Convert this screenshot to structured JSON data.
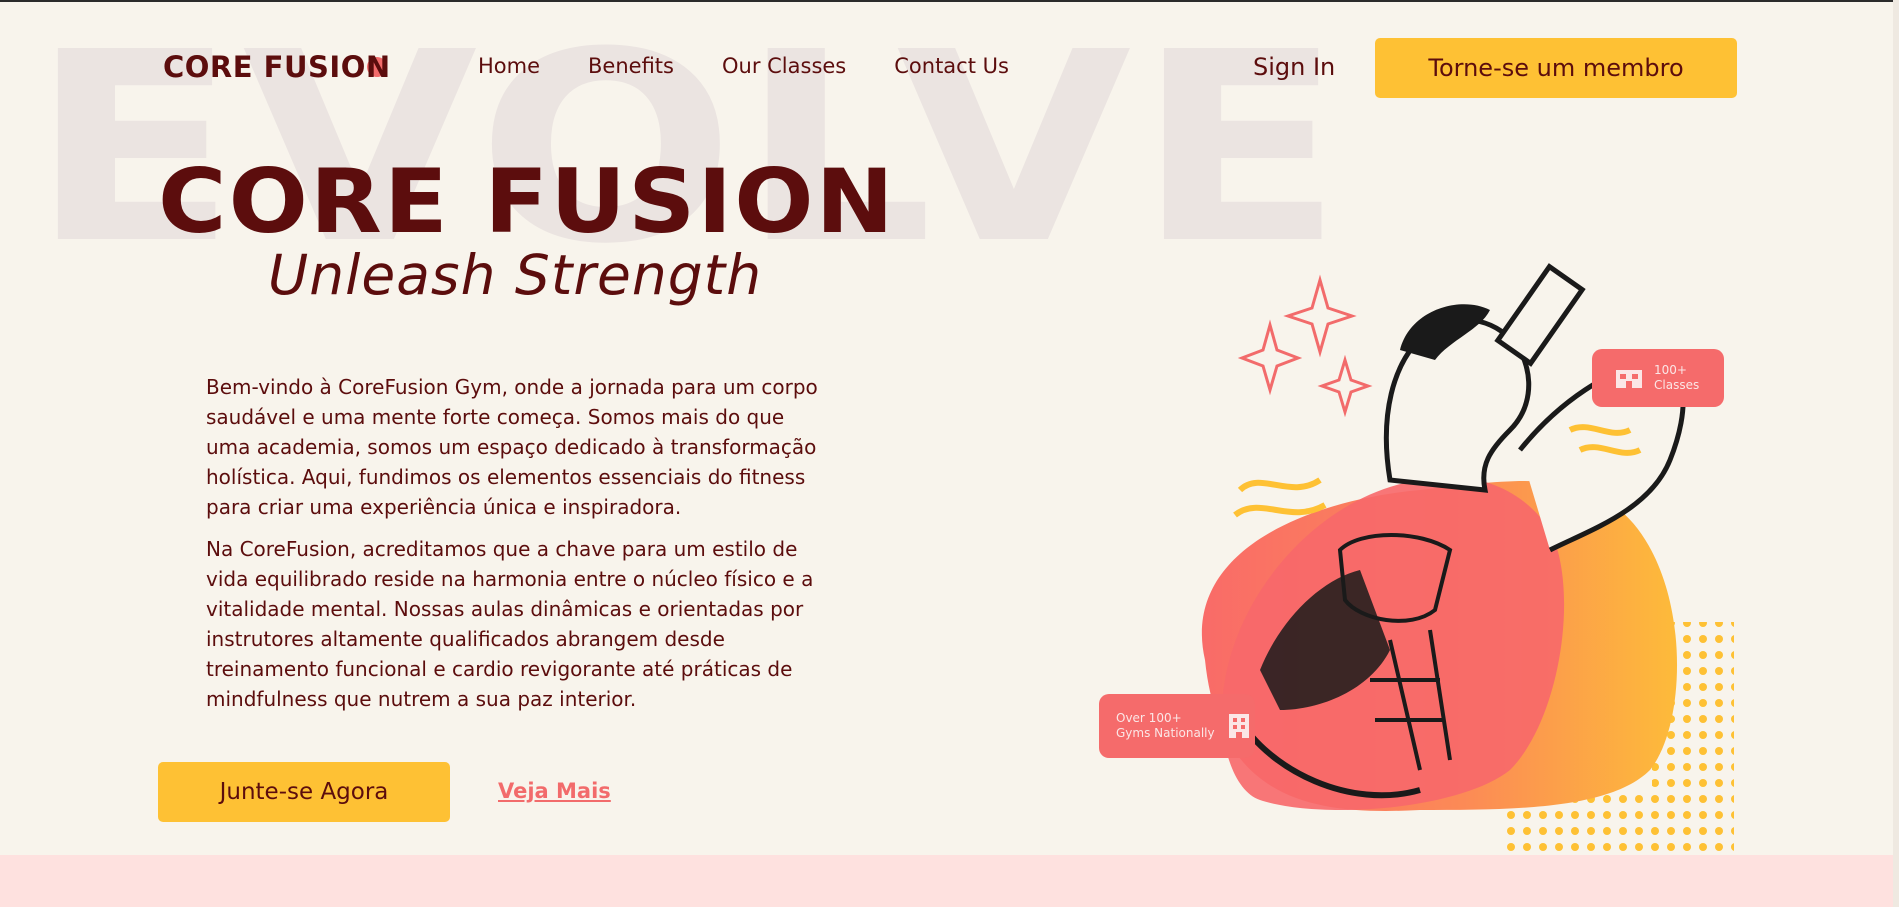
{
  "background_word": "EVOLVE",
  "colors": {
    "background": "#f8f4ec",
    "primary_text": "#5c0d0d",
    "accent_yellow": "#fec134",
    "accent_coral": "#f26b6b",
    "bottom_band": "#fee1df"
  },
  "nav": {
    "logo": "CORE FUSION",
    "links": [
      "Home",
      "Benefits",
      "Our Classes",
      "Contact Us"
    ],
    "sign_in": "Sign In",
    "cta": "Torne-se um membro"
  },
  "hero": {
    "title": "CORE FUSION",
    "subtitle": "Unleash Strength",
    "paragraphs": [
      "Bem-vindo à CoreFusion Gym, onde a jornada para um corpo saudável e uma mente forte começa. Somos mais do que uma academia, somos um espaço dedicado à transformação holística. Aqui, fundimos os elementos essenciais do fitness para criar uma experiência única e inspiradora.",
      "Na CoreFusion, acreditamos que a chave para um estilo de vida equilibrado reside na harmonia entre o núcleo físico e a vitalidade mental. Nossas aulas dinâmicas e orientadas por instrutores altamente qualificados abrangem desde treinamento funcional e cardio revigorante até práticas de mindfulness que nutrem a sua paz interior."
    ],
    "primary_button": "Junte-se Agora",
    "secondary_link": "Veja Mais"
  },
  "illustration": {
    "badges": [
      {
        "text": "100+\nClasses",
        "icon": "building-icon"
      },
      {
        "text": "Over 100+\nGyms Nationally",
        "icon": "office-building-icon"
      }
    ]
  }
}
